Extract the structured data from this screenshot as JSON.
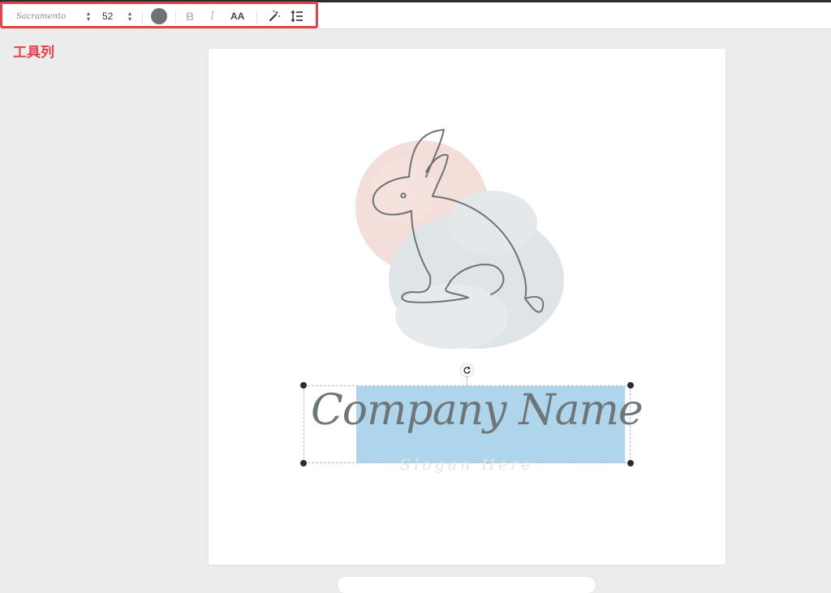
{
  "toolbar": {
    "font_family": "Sacramento",
    "font_size": "52",
    "text_color": "#6b7376",
    "bold_label": "B",
    "italic_label": "I",
    "case_label": "AA",
    "effects_icon": "magic-wand-icon",
    "spacing_icon": "line-spacing-icon"
  },
  "annotation": {
    "label": "工具列",
    "color": "#e0434a"
  },
  "canvas": {
    "company_name": "Company Name",
    "slogan": "Slogan Here",
    "selection_color": "#aed5ec",
    "logo": {
      "name": "rabbit-line-logo",
      "blush_color": "#f1d8d3",
      "mist_color": "#dfe4e6",
      "stroke_color": "#6c7376"
    }
  }
}
